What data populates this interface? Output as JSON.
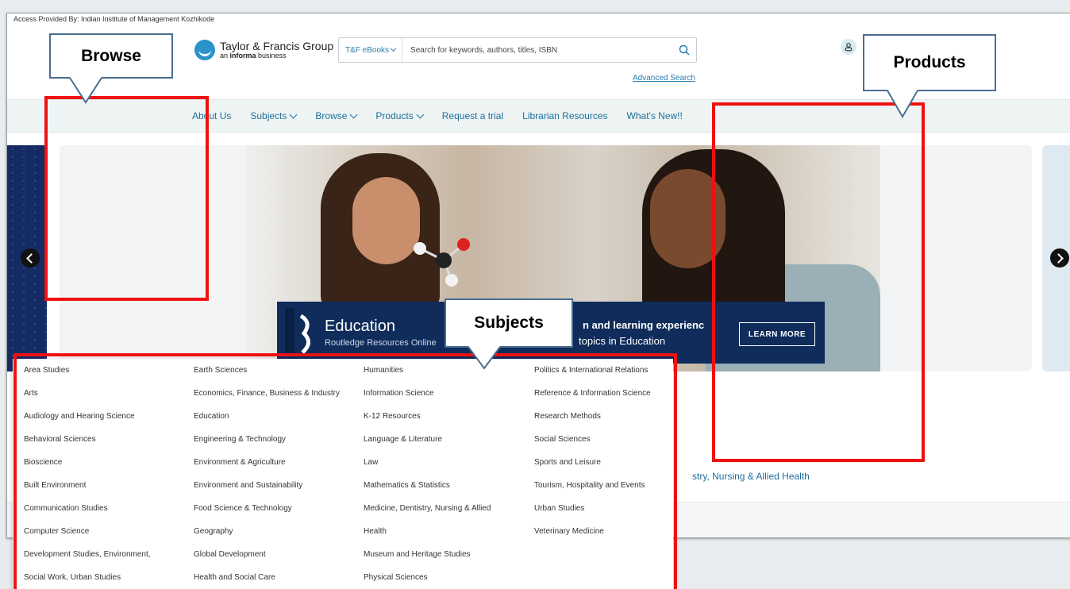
{
  "access_text": "Access Provided By: Indian Institute of Management Kozhikode",
  "logo": {
    "line1": "Taylor & Francis Group",
    "line2_prefix": "an ",
    "line2_bold": "informa",
    "line2_suffix": " business"
  },
  "search": {
    "scope": "T&F eBooks",
    "placeholder": "Search for keywords, authors, titles, ISBN",
    "advanced": "Advanced Search"
  },
  "nav": {
    "items": [
      {
        "label": "About Us",
        "dropdown": false
      },
      {
        "label": "Subjects",
        "dropdown": true
      },
      {
        "label": "Browse",
        "dropdown": true
      },
      {
        "label": "Products",
        "dropdown": true
      },
      {
        "label": "Request a trial",
        "dropdown": false
      },
      {
        "label": "Librarian Resources",
        "dropdown": false
      },
      {
        "label": "What's New!!",
        "dropdown": false
      }
    ]
  },
  "banner": {
    "title": "Education",
    "subtitle": "Routledge Resources Online",
    "tagline": "n and learning experienc",
    "tagline2": "topics in Education",
    "button": "LEARN MORE"
  },
  "footline": "stry, Nursing & Allied Health",
  "subjects": {
    "col1": [
      "Area Studies",
      "Arts",
      "Audiology and Hearing Science",
      "Behavioral Sciences",
      "Bioscience",
      "Built Environment",
      "Communication Studies",
      "Computer Science",
      "Development Studies, Environment,",
      "Social Work, Urban Studies"
    ],
    "col2": [
      "Earth Sciences",
      "Economics, Finance, Business & Industry",
      "Education",
      "Engineering & Technology",
      "Environment & Agriculture",
      "Environment and Sustainability",
      "Food Science & Technology",
      "Geography",
      "Global Development",
      "Health and Social Care"
    ],
    "col3": [
      "Humanities",
      "Information Science",
      "K-12 Resources",
      "Language & Literature",
      "Law",
      "Mathematics & Statistics",
      "Medicine, Dentistry, Nursing & Allied",
      "Health",
      "Museum and Heritage Studies",
      "Physical Sciences"
    ],
    "col4": [
      "Politics & International Relations",
      "Reference & Information Science",
      "Research Methods",
      "Social Sciences",
      "Sports and Leisure",
      "Tourism, Hospitality and Events",
      "Urban Studies",
      "Veterinary Medicine"
    ]
  },
  "callouts": {
    "browse": "Browse",
    "products": "Products",
    "subjects": "Subjects"
  },
  "colors": {
    "annotation_red": "#ee1111",
    "link_blue": "#1d6f9a",
    "banner_navy": "#0f2c5b"
  }
}
